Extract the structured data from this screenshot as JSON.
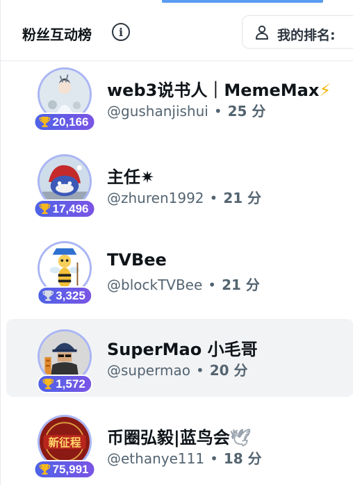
{
  "header": {
    "title": "粉丝互动榜",
    "info_icon": "info-icon",
    "my_rank_label": "我的排名:"
  },
  "colors": {
    "accent_blue": "#5b9bf2",
    "badge_gradient_start": "#4e63e6",
    "badge_gradient_end": "#7a54e5",
    "highlight_row": "#f2f3f5"
  },
  "entries": [
    {
      "name": "web3说书人｜MemeMax",
      "suffix": "⚡",
      "handle": "@gushanjishui",
      "score": "25 分",
      "fans": "20,166",
      "trophy": "gold"
    },
    {
      "name": "主任",
      "suffix": "✷",
      "handle": "@zhuren1992",
      "score": "21 分",
      "fans": "17,496",
      "trophy": "gold"
    },
    {
      "name": "TVBee",
      "suffix": "",
      "handle": "@blockTVBee",
      "score": "21 分",
      "fans": "3,325",
      "trophy": "silver"
    },
    {
      "name": "SuperMao 小毛哥",
      "suffix": "",
      "handle": "@supermao",
      "score": "20 分",
      "fans": "1,572",
      "trophy": "gold"
    },
    {
      "name": "币圈弘毅|蓝鸟会",
      "suffix": "🕊",
      "handle": "@ethanye111",
      "score": "18 分",
      "fans": "75,991",
      "trophy": "gold"
    }
  ]
}
